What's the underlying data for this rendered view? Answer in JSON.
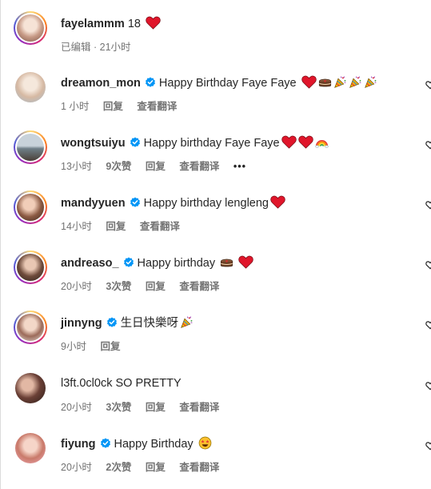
{
  "top": {
    "user": "fayelammm",
    "text": "18",
    "meta_edited": "已编辑",
    "meta_time": "21小时"
  },
  "comments": [
    {
      "user": "dreamon_mon",
      "text": "Happy Birthday Faye Faye",
      "time": "1 小时",
      "likes": "",
      "reply": "回复",
      "translate": "查看翻译"
    },
    {
      "user": "wongtsuiyu",
      "text": "Happy birthday Faye Faye",
      "time": "13小时",
      "likes": "9次赞",
      "reply": "回复",
      "translate": "查看翻译",
      "more": "•••"
    },
    {
      "user": "mandyyuen",
      "text": "Happy birthday lengleng",
      "time": "14小时",
      "likes": "",
      "reply": "回复",
      "translate": "查看翻译"
    },
    {
      "user": "andreaso_",
      "text": "Happy birthday",
      "time": "20小时",
      "likes": "3次赞",
      "reply": "回复",
      "translate": "查看翻译"
    },
    {
      "user": "jinnyng",
      "text": "生日快樂呀",
      "time": "9小时",
      "likes": "",
      "reply": "回复",
      "translate": ""
    },
    {
      "user": "l3ft.0cl0ck",
      "text": "SO PRETTY",
      "time": "20小时",
      "likes": "3次赞",
      "reply": "回复",
      "translate": "查看翻译"
    },
    {
      "user": "fiyung",
      "text": "Happy Birthday",
      "time": "20小时",
      "likes": "2次赞",
      "reply": "回复",
      "translate": "查看翻译"
    }
  ],
  "icons": {
    "verified": "verified-badge-icon",
    "heart": "heart-icon",
    "cake": "cake-emoji-icon",
    "popper": "party-popper-icon",
    "rainbow": "rainbow-icon",
    "star_eyes": "star-struck-emoji-icon",
    "like": "like-heart-outline-icon"
  },
  "colors": {
    "verified": "#0095f6",
    "heart": "#ed1b2f",
    "meta": "#737373"
  }
}
